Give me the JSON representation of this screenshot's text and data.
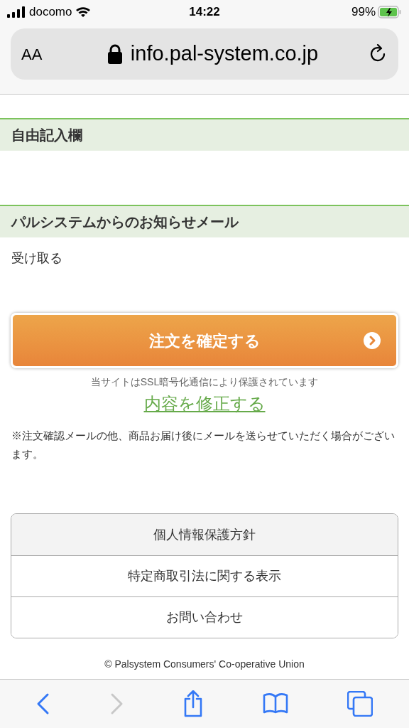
{
  "status_bar": {
    "carrier": "docomo",
    "time": "14:22",
    "battery": "99%"
  },
  "address_bar": {
    "text_size": "AA",
    "url": "info.pal-system.co.jp"
  },
  "sections": [
    {
      "heading": "自由記入欄"
    },
    {
      "heading": "パルシステムからのお知らせメール",
      "value": "受け取る"
    }
  ],
  "confirm_button": {
    "label": "注文を確定する"
  },
  "ssl_note": "当サイトはSSL暗号化通信により保護されています",
  "edit_link": "内容を修正する",
  "notice": "※注文確認メールの他、商品お届け後にメールを送らせていただく場合がございます。",
  "footer_links": [
    {
      "label": "個人情報保護方針",
      "highlighted": true
    },
    {
      "label": "特定商取引法に関する表示",
      "highlighted": false
    },
    {
      "label": "お問い合わせ",
      "highlighted": false
    }
  ],
  "copyright": "© Palsystem Consumers' Co-operative Union",
  "toolbar": {
    "back_disabled": false,
    "forward_disabled": true
  }
}
